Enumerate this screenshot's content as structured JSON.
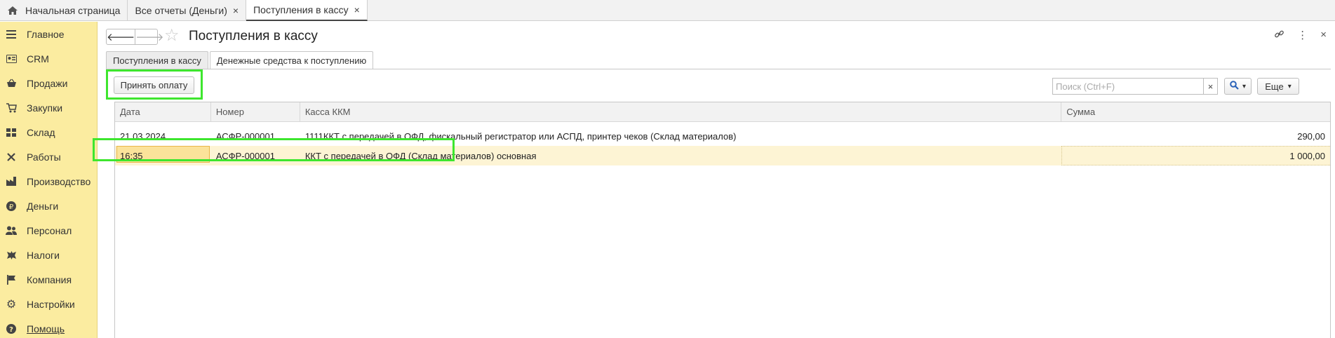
{
  "tabs": [
    {
      "label": "Начальная страница",
      "icon": "home-icon",
      "closable": false,
      "active": false
    },
    {
      "label": "Все отчеты (Деньги)",
      "closable": true,
      "active": false
    },
    {
      "label": "Поступления в кассу",
      "closable": true,
      "active": true
    }
  ],
  "sidebar": {
    "items": [
      {
        "label": "Главное",
        "icon": "menu-icon"
      },
      {
        "label": "CRM",
        "icon": "crm-card-icon"
      },
      {
        "label": "Продажи",
        "icon": "basket-icon"
      },
      {
        "label": "Закупки",
        "icon": "cart-icon"
      },
      {
        "label": "Склад",
        "icon": "warehouse-icon"
      },
      {
        "label": "Работы",
        "icon": "tools-icon"
      },
      {
        "label": "Производство",
        "icon": "factory-icon"
      },
      {
        "label": "Деньги",
        "icon": "ruble-icon"
      },
      {
        "label": "Персонал",
        "icon": "people-icon"
      },
      {
        "label": "Налоги",
        "icon": "emblem-icon"
      },
      {
        "label": "Компания",
        "icon": "flag-icon"
      },
      {
        "label": "Настройки",
        "icon": "gear-icon"
      },
      {
        "label": "Помощь",
        "icon": "help-icon"
      }
    ]
  },
  "header": {
    "title": "Поступления в кассу",
    "back": "🡐",
    "forward": "🡒",
    "star": "☆",
    "link_icon": "🔗",
    "more_icon": "⋮",
    "close_icon": "×"
  },
  "form_tabs": [
    {
      "label": "Поступления в кассу",
      "active": false
    },
    {
      "label": "Денежные средства к поступлению",
      "active": true
    }
  ],
  "toolbar": {
    "accept_payment": "Принять оплату",
    "search_placeholder": "Поиск (Ctrl+F)",
    "search_clear": "×",
    "more": "Еще",
    "dropdown_arrow": "▾"
  },
  "table": {
    "columns": [
      "Дата",
      "Номер",
      "Касса ККМ",
      "Сумма"
    ],
    "rows": [
      {
        "date": "21.03.2024",
        "number": "АСФР-000001",
        "kkm": "1111ККТ с передачей в ОФД, фискальный регистратор или АСПД, принтер чеков (Склад материалов)",
        "amount": "290,00",
        "selected": false
      },
      {
        "date": "16:35",
        "number": "АСФР-000001",
        "kkm": "ККТ с передачей в ОФД (Склад материалов) основная",
        "amount": "1 000,00",
        "selected": true
      }
    ]
  },
  "colors": {
    "sidebar_bg": "#fbeca0",
    "highlight": "#3ee62e",
    "selected_row": "#fdf4d4",
    "selected_cell": "#fbe39a"
  }
}
